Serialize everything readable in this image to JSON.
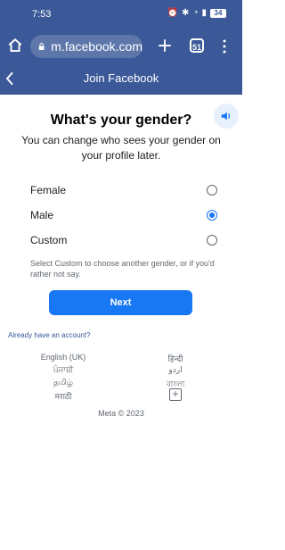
{
  "status_bar": {
    "time": "7:53",
    "battery": "34"
  },
  "browser": {
    "url": "m.facebook.com",
    "tab_count": "51"
  },
  "header": {
    "title": "Join Facebook"
  },
  "main": {
    "title": "What's your gender?",
    "subtitle": "You can change who sees your gender on your profile later.",
    "options": [
      {
        "label": "Female",
        "checked": false
      },
      {
        "label": "Male",
        "checked": true
      },
      {
        "label": "Custom",
        "checked": false
      }
    ],
    "hint": "Select Custom to choose another gender, or if you'd rather not say.",
    "next_label": "Next"
  },
  "footer": {
    "already": "Already have an account?",
    "languages_left": [
      "English (UK)",
      "ਪੰਜਾਬੀ",
      "தமிழ்",
      "मराठी"
    ],
    "languages_right": [
      "हिन्दी",
      "اردو",
      "বাংলা"
    ],
    "copyright": "Meta © 2023"
  },
  "colors": {
    "brand": "#3b5998",
    "primary_button": "#1877f2",
    "link": "#385898"
  },
  "icons": {
    "home": "home-icon",
    "lock": "lock-icon",
    "plus": "plus-icon",
    "menu": "menu-icon",
    "back": "back-icon",
    "sound": "speaker-icon",
    "more_languages": "plus-icon"
  }
}
